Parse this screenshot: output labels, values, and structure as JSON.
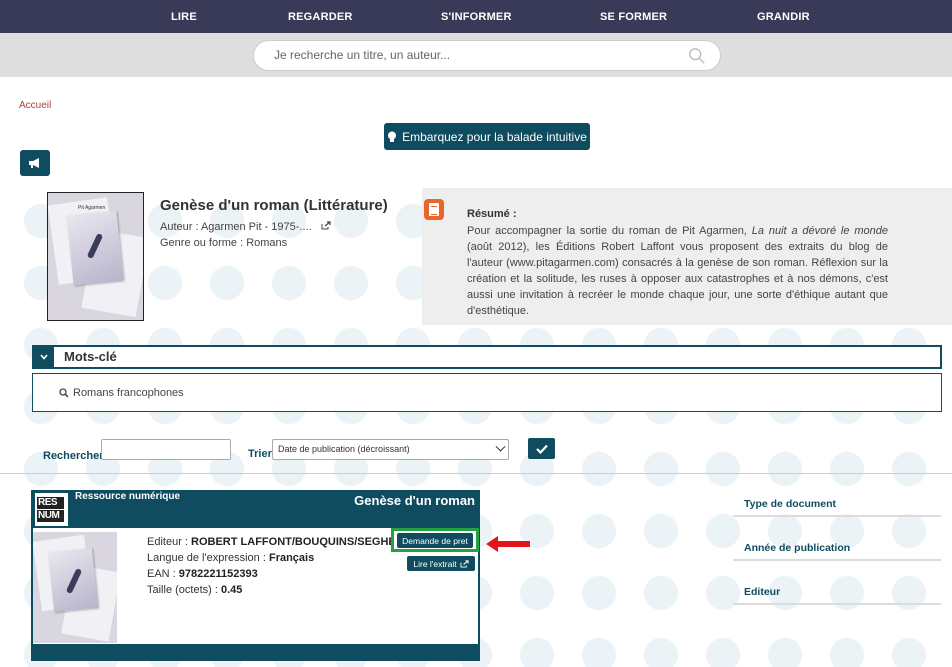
{
  "nav": {
    "items": [
      "LIRE",
      "REGARDER",
      "S'INFORMER",
      "SE FORMER",
      "GRANDIR"
    ]
  },
  "search": {
    "placeholder": "Je recherche un titre, un auteur..."
  },
  "breadcrumb": {
    "home": "Accueil"
  },
  "balade_button": {
    "label": "Embarquez pour la balade intuitive",
    "icon": "lightbulb-icon"
  },
  "megaphone": {
    "icon": "megaphone-icon"
  },
  "record": {
    "title": "Genèse d'un roman (Littérature)",
    "author_label": "Auteur : Agarmen Pit - 1975-....",
    "genre_label": "Genre ou forme : Romans",
    "cover_text": "Pit Agarmen"
  },
  "resume": {
    "label": "Résumé :",
    "text_1": "Pour accompagner la sortie du roman de Pit Agarmen, ",
    "text_italic": "La nuit a dévoré le monde",
    "text_2": " (août 2012), les Éditions Robert Laffont vous proposent des extraits du blog de l'auteur (www.pitagarmen.com) consacrés à la genèse de son roman. Réflexion sur la création et la solitude, les ruses à opposer aux catastrophes et à nos démons, c'est aussi une invitation à recréer le monde chaque jour, une sorte d'éthique autant que d'esthétique."
  },
  "keywords": {
    "title": "Mots-clé",
    "items": [
      "Romans francophones"
    ]
  },
  "filters": {
    "search_label": "Rechercher",
    "sort_label": "Trier",
    "sort_selected": "Date de publication (décroissant)"
  },
  "result": {
    "badge_line1": "RES",
    "badge_line2": "NUM",
    "type": "Ressource numérique",
    "title": "Genèse d'un roman",
    "editor_label": "Editeur : ",
    "editor_value": "ROBERT LAFFONT/BOUQUINS/SEGHERS",
    "lang_label": "Langue de l'expression : ",
    "lang_value": "Français",
    "ean_label": "EAN : ",
    "ean_value": "9782221152393",
    "size_label": "Taille (octets) : ",
    "size_value": "0.45",
    "pret_button": "Demande de pret",
    "extrait_button": "Lire l'extrait"
  },
  "facets": [
    "Type de document",
    "Année de publication",
    "Editeur"
  ],
  "colors": {
    "nav_bg": "#383a57",
    "accent": "#0f4c60",
    "highlight": "#23a244",
    "arrow": "#e0161b"
  }
}
